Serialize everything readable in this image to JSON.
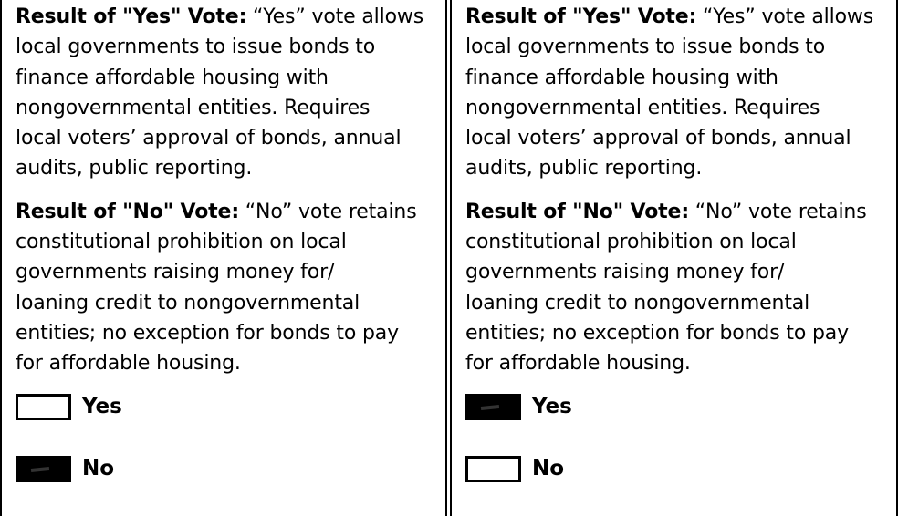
{
  "panels": [
    {
      "yes_lead": "Result of \"Yes\" Vote:",
      "yes_text_lines": [
        " “Yes” vote allows",
        "local governments to issue bonds to",
        "finance affordable housing with",
        "nongovernmental entities. Requires",
        "local voters’ approval of bonds, annual",
        "audits, public reporting."
      ],
      "no_lead": "Result of \"No\" Vote:",
      "no_text_lines": [
        " “No” vote retains",
        "constitutional prohibition on local",
        "governments raising money for/",
        "loaning credit to nongovernmental",
        "entities; no exception for bonds to pay",
        "for affordable housing."
      ],
      "yes_label": "Yes",
      "no_label": "No",
      "yes_marked": false,
      "no_marked": true
    },
    {
      "yes_lead": "Result of \"Yes\" Vote:",
      "yes_text_lines": [
        " “Yes” vote allows",
        "local governments to issue bonds to",
        "finance affordable housing with",
        "nongovernmental entities. Requires",
        "local voters’ approval of bonds, annual",
        "audits, public reporting."
      ],
      "no_lead": "Result of \"No\" Vote:",
      "no_text_lines": [
        " “No” vote retains",
        "constitutional prohibition on local",
        "governments raising money for/",
        "loaning credit to nongovernmental",
        "entities; no exception for bonds to pay",
        "for affordable housing."
      ],
      "yes_label": "Yes",
      "no_label": "No",
      "yes_marked": true,
      "no_marked": false
    }
  ]
}
